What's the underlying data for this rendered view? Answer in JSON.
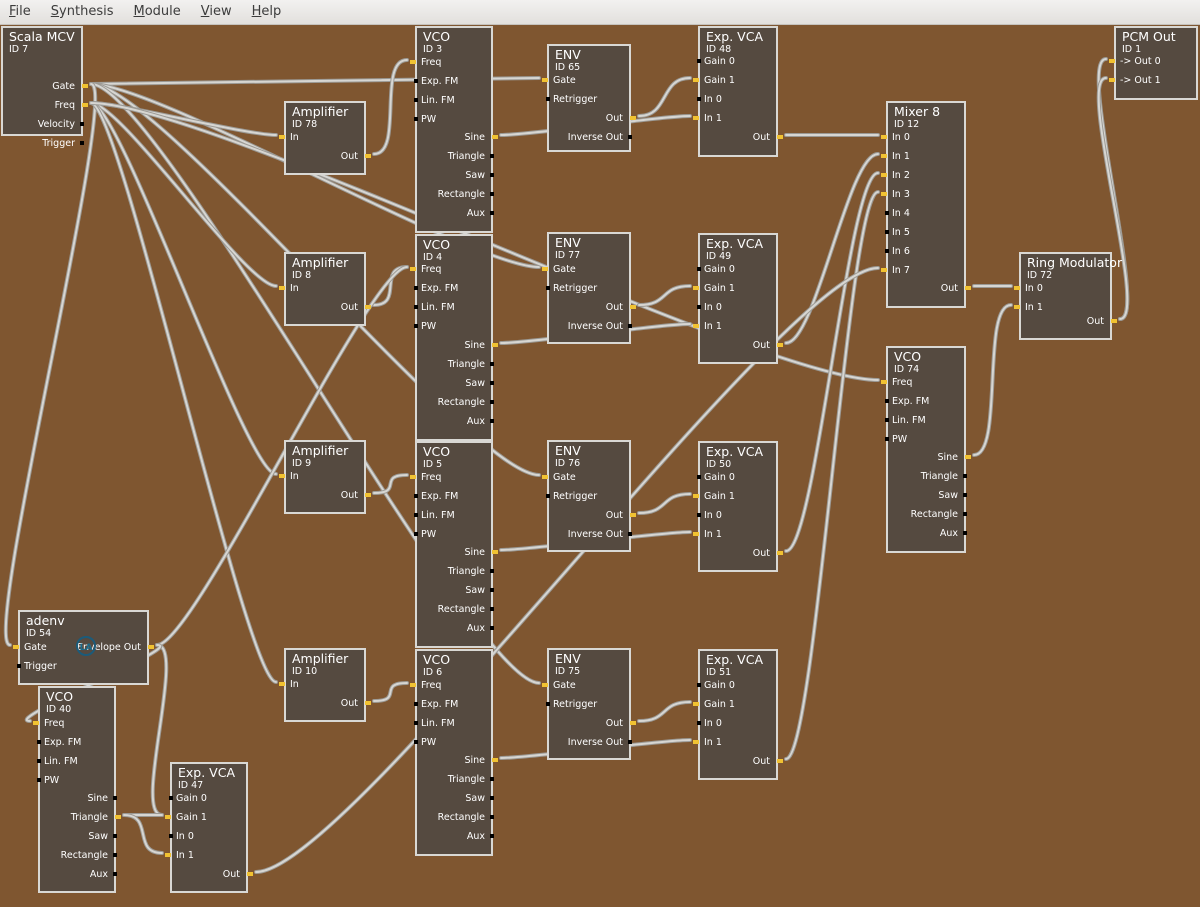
{
  "menu": [
    "File",
    "Synthesis",
    "Module",
    "View",
    "Help"
  ],
  "colors": {
    "canvas": "#7f5630",
    "module_bg": "#554a40",
    "module_border": "#d9d8d4",
    "port_connected": "#f1c232",
    "wire": "#9b9994"
  },
  "icons": {
    "adenv_logo": "LADSPA-logo-icon"
  },
  "modules": [
    {
      "key": "scala",
      "title": "Scala MCV",
      "id_label": "ID 7",
      "inputs": [],
      "outputs": [
        "Gate",
        "Freq",
        "Velocity",
        "Trigger"
      ]
    },
    {
      "key": "amp78",
      "title": "Amplifier",
      "id_label": "ID 78",
      "inputs": [
        "In"
      ],
      "outputs": [
        "Out"
      ]
    },
    {
      "key": "amp8",
      "title": "Amplifier",
      "id_label": "ID 8",
      "inputs": [
        "In"
      ],
      "outputs": [
        "Out"
      ]
    },
    {
      "key": "amp9",
      "title": "Amplifier",
      "id_label": "ID 9",
      "inputs": [
        "In"
      ],
      "outputs": [
        "Out"
      ]
    },
    {
      "key": "amp10",
      "title": "Amplifier",
      "id_label": "ID 10",
      "inputs": [
        "In"
      ],
      "outputs": [
        "Out"
      ]
    },
    {
      "key": "vco3",
      "title": "VCO",
      "id_label": "ID 3",
      "inputs": [
        "Freq",
        "Exp. FM",
        "Lin. FM",
        "PW"
      ],
      "outputs": [
        "Sine",
        "Triangle",
        "Saw",
        "Rectangle",
        "Aux"
      ]
    },
    {
      "key": "vco4",
      "title": "VCO",
      "id_label": "ID 4",
      "inputs": [
        "Freq",
        "Exp. FM",
        "Lin. FM",
        "PW"
      ],
      "outputs": [
        "Sine",
        "Triangle",
        "Saw",
        "Rectangle",
        "Aux"
      ]
    },
    {
      "key": "vco5",
      "title": "VCO",
      "id_label": "ID 5",
      "inputs": [
        "Freq",
        "Exp. FM",
        "Lin. FM",
        "PW"
      ],
      "outputs": [
        "Sine",
        "Triangle",
        "Saw",
        "Rectangle",
        "Aux"
      ]
    },
    {
      "key": "vco6",
      "title": "VCO",
      "id_label": "ID 6",
      "inputs": [
        "Freq",
        "Exp. FM",
        "Lin. FM",
        "PW"
      ],
      "outputs": [
        "Sine",
        "Triangle",
        "Saw",
        "Rectangle",
        "Aux"
      ]
    },
    {
      "key": "env65",
      "title": "ENV",
      "id_label": "ID 65",
      "inputs": [
        "Gate",
        "Retrigger"
      ],
      "outputs": [
        "Out",
        "Inverse Out"
      ]
    },
    {
      "key": "env77",
      "title": "ENV",
      "id_label": "ID 77",
      "inputs": [
        "Gate",
        "Retrigger"
      ],
      "outputs": [
        "Out",
        "Inverse Out"
      ]
    },
    {
      "key": "env76",
      "title": "ENV",
      "id_label": "ID 76",
      "inputs": [
        "Gate",
        "Retrigger"
      ],
      "outputs": [
        "Out",
        "Inverse Out"
      ]
    },
    {
      "key": "env75",
      "title": "ENV",
      "id_label": "ID 75",
      "inputs": [
        "Gate",
        "Retrigger"
      ],
      "outputs": [
        "Out",
        "Inverse Out"
      ]
    },
    {
      "key": "vca48",
      "title": "Exp. VCA",
      "id_label": "ID 48",
      "inputs": [
        "Gain 0",
        "Gain 1",
        "In 0",
        "In 1"
      ],
      "outputs": [
        "Out"
      ]
    },
    {
      "key": "vca49",
      "title": "Exp. VCA",
      "id_label": "ID 49",
      "inputs": [
        "Gain 0",
        "Gain 1",
        "In 0",
        "In 1"
      ],
      "outputs": [
        "Out"
      ]
    },
    {
      "key": "vca50",
      "title": "Exp. VCA",
      "id_label": "ID 50",
      "inputs": [
        "Gain 0",
        "Gain 1",
        "In 0",
        "In 1"
      ],
      "outputs": [
        "Out"
      ]
    },
    {
      "key": "vca51",
      "title": "Exp. VCA",
      "id_label": "ID 51",
      "inputs": [
        "Gain 0",
        "Gain 1",
        "In 0",
        "In 1"
      ],
      "outputs": [
        "Out"
      ]
    },
    {
      "key": "mixer",
      "title": "Mixer 8",
      "id_label": "ID 12",
      "inputs": [
        "In 0",
        "In 1",
        "In 2",
        "In 3",
        "In 4",
        "In 5",
        "In 6",
        "In 7"
      ],
      "outputs": [
        "Out"
      ]
    },
    {
      "key": "ring",
      "title": "Ring Modulator",
      "id_label": "ID 72",
      "inputs": [
        "In 0",
        "In 1"
      ],
      "outputs": [
        "Out"
      ]
    },
    {
      "key": "vco74",
      "title": "VCO",
      "id_label": "ID 74",
      "inputs": [
        "Freq",
        "Exp. FM",
        "Lin. FM",
        "PW"
      ],
      "outputs": [
        "Sine",
        "Triangle",
        "Saw",
        "Rectangle",
        "Aux"
      ]
    },
    {
      "key": "pcm",
      "title": "PCM Out",
      "id_label": "ID 1",
      "inputs": [
        "-> Out  0",
        "-> Out  1"
      ],
      "outputs": []
    },
    {
      "key": "adenv",
      "title": "adenv",
      "id_label": "ID 54",
      "inputs": [
        "Gate",
        "Trigger"
      ],
      "outputs": [
        "Envelope Out"
      ]
    },
    {
      "key": "vco40",
      "title": "VCO",
      "id_label": "ID 40",
      "inputs": [
        "Freq",
        "Exp. FM",
        "Lin. FM",
        "PW"
      ],
      "outputs": [
        "Sine",
        "Triangle",
        "Saw",
        "Rectangle",
        "Aux"
      ]
    },
    {
      "key": "vca47",
      "title": "Exp. VCA",
      "id_label": "ID 47",
      "inputs": [
        "Gain 0",
        "Gain 1",
        "In 0",
        "In 1"
      ],
      "outputs": [
        "Out"
      ]
    }
  ],
  "connections": [
    [
      "scala",
      "out",
      "Gate",
      "env65",
      "in",
      "Gate"
    ],
    [
      "scala",
      "out",
      "Gate",
      "env77",
      "in",
      "Gate"
    ],
    [
      "scala",
      "out",
      "Gate",
      "env76",
      "in",
      "Gate"
    ],
    [
      "scala",
      "out",
      "Gate",
      "env75",
      "in",
      "Gate"
    ],
    [
      "scala",
      "out",
      "Gate",
      "adenv",
      "in",
      "Gate"
    ],
    [
      "scala",
      "out",
      "Freq",
      "amp78",
      "in",
      "In"
    ],
    [
      "scala",
      "out",
      "Freq",
      "amp8",
      "in",
      "In"
    ],
    [
      "scala",
      "out",
      "Freq",
      "amp9",
      "in",
      "In"
    ],
    [
      "scala",
      "out",
      "Freq",
      "amp10",
      "in",
      "In"
    ],
    [
      "scala",
      "out",
      "Freq",
      "vco74",
      "in",
      "Freq"
    ],
    [
      "amp78",
      "out",
      "Out",
      "vco3",
      "in",
      "Freq"
    ],
    [
      "amp8",
      "out",
      "Out",
      "vco4",
      "in",
      "Freq"
    ],
    [
      "amp9",
      "out",
      "Out",
      "vco5",
      "in",
      "Freq"
    ],
    [
      "amp10",
      "out",
      "Out",
      "vco6",
      "in",
      "Freq"
    ],
    [
      "vco3",
      "out",
      "Sine",
      "vca48",
      "in",
      "In 1"
    ],
    [
      "vco4",
      "out",
      "Sine",
      "vca49",
      "in",
      "In 1"
    ],
    [
      "vco5",
      "out",
      "Sine",
      "vca50",
      "in",
      "In 1"
    ],
    [
      "vco6",
      "out",
      "Sine",
      "vca51",
      "in",
      "In 1"
    ],
    [
      "env65",
      "out",
      "Out",
      "vca48",
      "in",
      "Gain 1"
    ],
    [
      "env77",
      "out",
      "Out",
      "vca49",
      "in",
      "Gain 1"
    ],
    [
      "env76",
      "out",
      "Out",
      "vca50",
      "in",
      "Gain 1"
    ],
    [
      "env75",
      "out",
      "Out",
      "vca51",
      "in",
      "Gain 1"
    ],
    [
      "vca48",
      "out",
      "Out",
      "mixer",
      "in",
      "In 0"
    ],
    [
      "vca49",
      "out",
      "Out",
      "mixer",
      "in",
      "In 1"
    ],
    [
      "vca50",
      "out",
      "Out",
      "mixer",
      "in",
      "In 2"
    ],
    [
      "vca51",
      "out",
      "Out",
      "mixer",
      "in",
      "In 3"
    ],
    [
      "vca47",
      "out",
      "Out",
      "mixer",
      "in",
      "In 7"
    ],
    [
      "mixer",
      "out",
      "Out",
      "ring",
      "in",
      "In 0"
    ],
    [
      "vco74",
      "out",
      "Sine",
      "ring",
      "in",
      "In 1"
    ],
    [
      "ring",
      "out",
      "Out",
      "pcm",
      "in",
      "-> Out  0"
    ],
    [
      "ring",
      "out",
      "Out",
      "pcm",
      "in",
      "-> Out  1"
    ],
    [
      "adenv",
      "out",
      "Envelope Out",
      "vca47",
      "in",
      "Gain 1"
    ],
    [
      "adenv",
      "out",
      "Envelope Out",
      "vco4",
      "in",
      "Freq"
    ],
    [
      "adenv",
      "out",
      "Envelope Out",
      "vco40",
      "in",
      "Freq"
    ],
    [
      "vco40",
      "out",
      "Triangle",
      "vca47",
      "in",
      "Gain 1"
    ],
    [
      "vco40",
      "out",
      "Triangle",
      "vca47",
      "in",
      "In 1"
    ]
  ]
}
